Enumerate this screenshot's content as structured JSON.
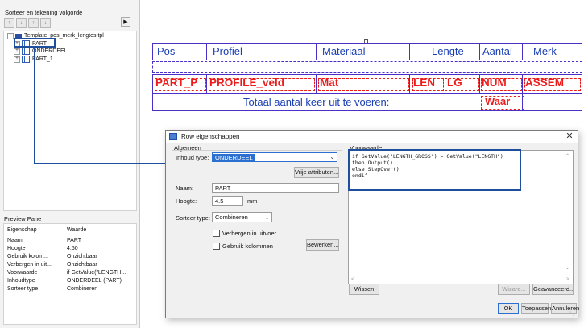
{
  "left_panel": {
    "sort_label": "Sorteer en tekening volgorde",
    "toolbar_icons": [
      "move-top-icon",
      "move-up-icon",
      "move-down-icon",
      "move-bottom-icon"
    ],
    "tree": {
      "root_label": "Template: pos_merk_lengtes.tpl",
      "items": [
        "PART",
        "ONDERDEEL",
        "PART_1"
      ]
    },
    "preview_title": "Preview Pane",
    "preview": {
      "header_key": "Eigenschap",
      "header_value": "Waarde",
      "rows": [
        {
          "k": "Naam",
          "v": "PART"
        },
        {
          "k": "Hoogte",
          "v": "4.50"
        },
        {
          "k": "Gebruik kolom...",
          "v": "Onzichtbaar"
        },
        {
          "k": "Verbergen in uit...",
          "v": "Onzichtbaar"
        },
        {
          "k": "Voorwaarde",
          "v": "if GetValue(\"LENGTH..."
        },
        {
          "k": "Inhoudtype",
          "v": "ONDERDEEL (PART)"
        },
        {
          "k": "Sorteer type",
          "v": "Combineren"
        }
      ]
    }
  },
  "report": {
    "headers": [
      "Pos",
      "Profiel",
      "Materiaal",
      "Lengte",
      "Aantal",
      "Merk"
    ],
    "fields": [
      "PART_P",
      "PROFILE_veld",
      "Mat",
      "LEN",
      "LG",
      "NUM",
      "ASSEM"
    ],
    "total_label": "Totaal aantal keer uit te voeren:",
    "total_field": "Waar"
  },
  "dialog": {
    "title": "Row eigenschappen",
    "general_label": "Algemeen",
    "content_type_label": "Inhoud type:",
    "content_type_value": "ONDERDEEL",
    "attributes_button": "Vrije attributen...",
    "name_label": "Naam:",
    "name_value": "PART",
    "height_label": "Hoogte:",
    "height_value": "4.5",
    "height_unit": "mm",
    "sort_type_label": "Sorteer type:",
    "sort_type_value": "Combineren",
    "hide_output_label": "Verbergen in uitvoer",
    "use_columns_label": "Gebruik kolommen",
    "edit_button": "Bewerken...",
    "condition_label": "Voorwaarde",
    "code_lines": [
      "if GetValue(\"LENGTH_GROSS\") > GetValue(\"LENGTH\")",
      "then Output()",
      "else StepOver()",
      "endif"
    ],
    "clear_button": "Wissen",
    "wizard_button": "Wizard...",
    "advanced_button": "Geavanceerd...",
    "ok_button": "OK",
    "apply_button": "Toepassen",
    "cancel_button": "Annuleren"
  }
}
